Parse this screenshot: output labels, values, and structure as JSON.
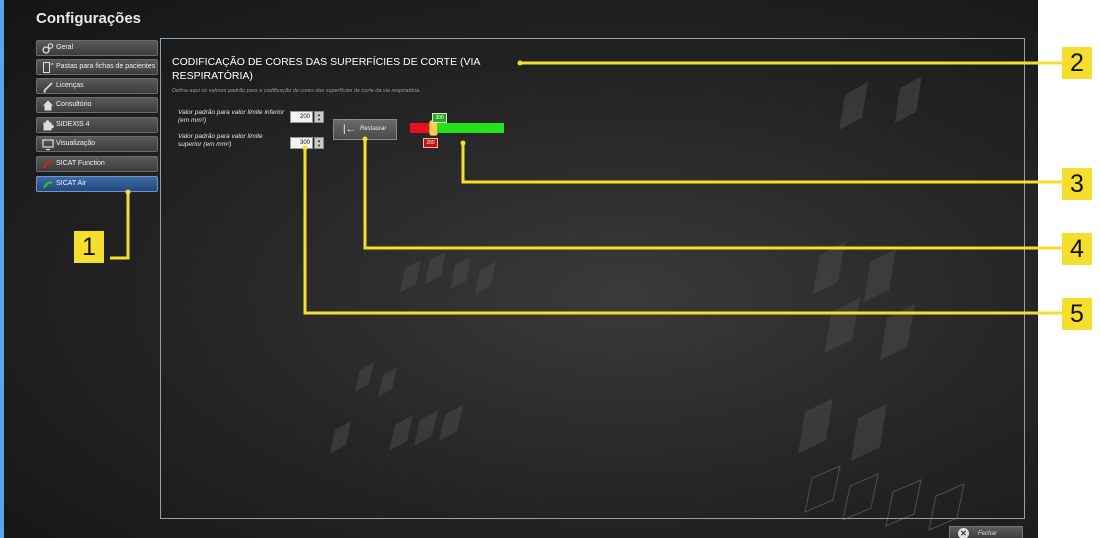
{
  "app": {
    "title": "Configurações"
  },
  "sidebar": {
    "items": [
      {
        "label": "Geral",
        "icon": "gears-icon",
        "active": false
      },
      {
        "label": "Pastas para fichas de pacientes",
        "icon": "folder-icon",
        "active": false
      },
      {
        "label": "Licenças",
        "icon": "pen-icon",
        "active": false
      },
      {
        "label": "Consultório",
        "icon": "house-icon",
        "active": false
      },
      {
        "label": "SIDEXIS 4",
        "icon": "puzzle-icon",
        "active": false
      },
      {
        "label": "Visualização",
        "icon": "monitor-icon",
        "active": false
      },
      {
        "label": "SICAT Function",
        "icon": "sicat-function-icon",
        "active": false
      },
      {
        "label": "SICAT Air",
        "icon": "sicat-air-icon",
        "active": true
      }
    ]
  },
  "panel": {
    "title": "CODIFICAÇÃO DE CORES DAS SUPERFÍCIES DE CORTE (VIA RESPIRATÓRIA)",
    "description": "Defina aqui os valores padrão para a codificação de cores das superfícies de corte da via respiratória.",
    "lower": {
      "label": "Valor padrão para valor limite inferior (em mm²)",
      "value": "200"
    },
    "upper": {
      "label": "Valor padrão para valor limite superior (em mm²)",
      "value": "300"
    },
    "restore_label": "Restaurar",
    "slider": {
      "upper_tag": "300",
      "lower_tag": "200",
      "colors": [
        "#e8101c",
        "#f1d13a",
        "#26e21a"
      ]
    }
  },
  "footer": {
    "close_label": "Fechar"
  },
  "callouts": [
    "1",
    "2",
    "3",
    "4",
    "5"
  ],
  "colors": {
    "accent": "#f6de2e",
    "active_nav": "#2c5288",
    "panel_border": "#8ea2b6"
  }
}
